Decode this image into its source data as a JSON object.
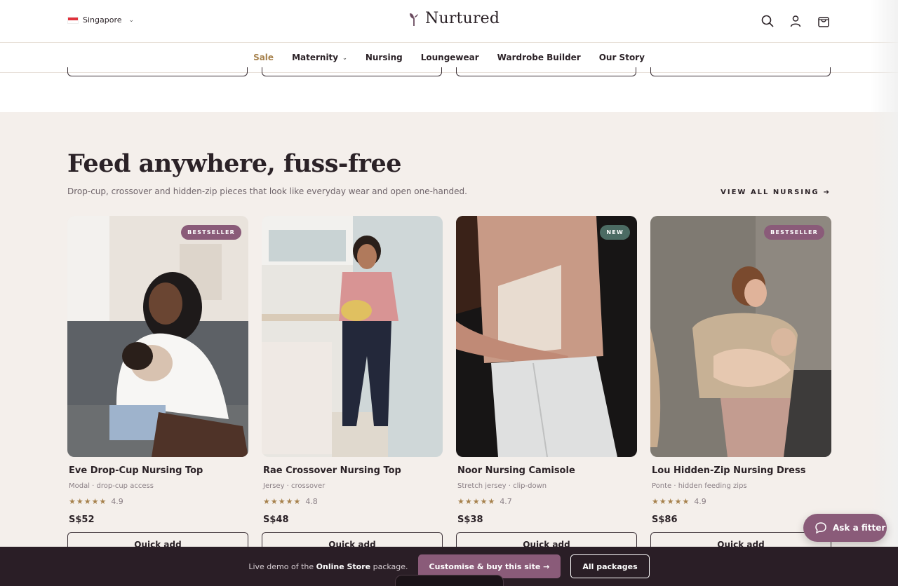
{
  "header": {
    "region_label": "Singapore",
    "brand": "Nurtured",
    "icons": [
      "search-icon",
      "account-icon",
      "bag-icon"
    ]
  },
  "nav": {
    "items": [
      {
        "label": "Sale"
      },
      {
        "label": "Maternity"
      },
      {
        "label": "Nursing"
      },
      {
        "label": "Loungewear"
      },
      {
        "label": "Wardrobe Builder"
      },
      {
        "label": "Our Story"
      }
    ]
  },
  "section": {
    "title": "Feed anywhere, fuss-free",
    "subtitle": "Drop-cup, crossover and hidden-zip pieces that look like everyday wear and open one-handed.",
    "view_all": "VIEW ALL NURSING"
  },
  "products": [
    {
      "name": "Eve Drop-Cup Nursing Top",
      "meta": "Modal · drop-cup access",
      "stars": "★★★★★",
      "rating": "4.9",
      "price": "S$52",
      "badge": "BESTSELLER",
      "button": "Quick add"
    },
    {
      "name": "Rae Crossover Nursing Top",
      "meta": "Jersey · crossover",
      "stars": "★★★★★",
      "rating": "4.8",
      "price": "S$48",
      "badge": "",
      "button": "Quick add"
    },
    {
      "name": "Noor Nursing Camisole",
      "meta": "Stretch jersey · clip-down",
      "stars": "★★★★★",
      "rating": "4.7",
      "price": "S$38",
      "badge": "NEW",
      "button": "Quick add"
    },
    {
      "name": "Lou Hidden-Zip Nursing Dress",
      "meta": "Ponte · hidden feeding zips",
      "stars": "★★★★★",
      "rating": "4.9",
      "price": "S$86",
      "badge": "BESTSELLER",
      "button": "Quick add"
    }
  ],
  "fitter": {
    "label": "Ask a fitter"
  },
  "demo": {
    "prefix": "Live demo of the",
    "package": "Online Store",
    "suffix": "package.",
    "customise": "Customise & buy this site →",
    "all_packages": "All packages"
  },
  "colors": {
    "accent": "#8a5b79",
    "gold": "#a6814c",
    "new_badge": "#4b6b63",
    "bar": "#2a1e26"
  }
}
